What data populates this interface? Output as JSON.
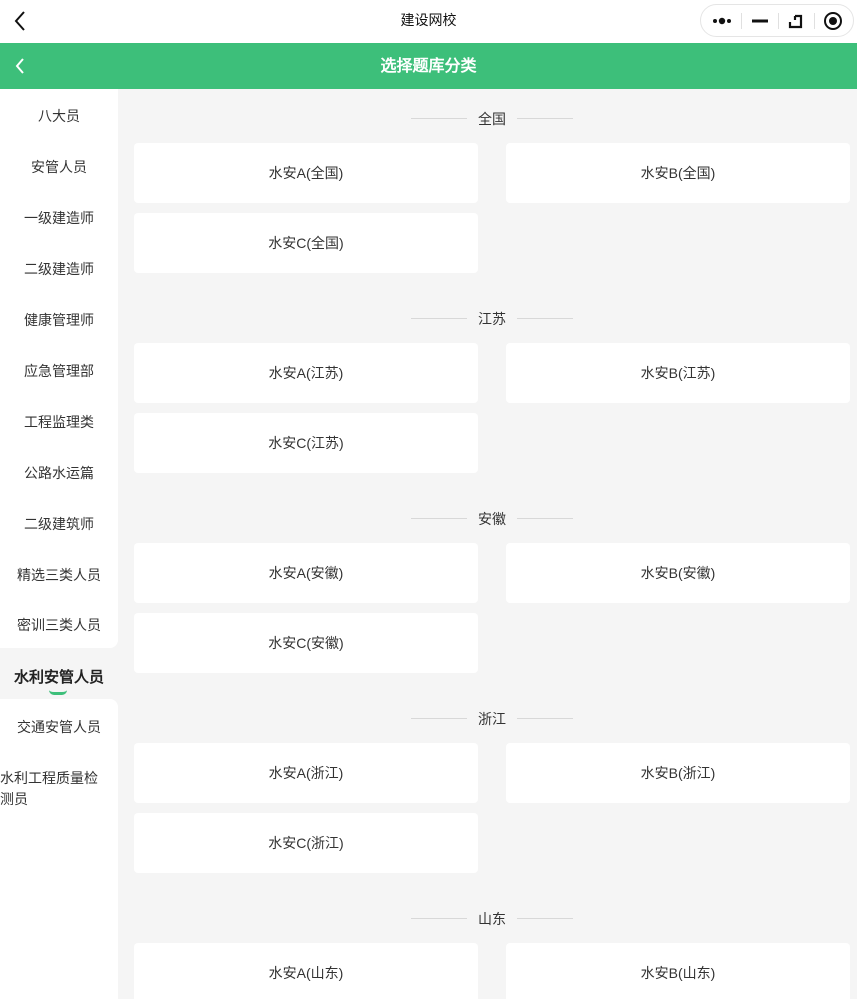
{
  "topbar": {
    "title": "建设网校"
  },
  "header": {
    "title": "选择题库分类"
  },
  "sidebar": {
    "items": [
      {
        "label": "八大员"
      },
      {
        "label": "安管人员"
      },
      {
        "label": "一级建造师"
      },
      {
        "label": "二级建造师"
      },
      {
        "label": "健康管理师"
      },
      {
        "label": "应急管理部"
      },
      {
        "label": "工程监理类"
      },
      {
        "label": "公路水运篇"
      },
      {
        "label": "二级建筑师"
      },
      {
        "label": "精选三类人员"
      },
      {
        "label": "密训三类人员"
      },
      {
        "label": "水利安管人员"
      },
      {
        "label": "交通安管人员"
      },
      {
        "label": "水利工程质量检",
        "label2": "测员"
      }
    ],
    "active_index": 11
  },
  "sections": [
    {
      "title": "全国",
      "items": [
        "水安A(全国)",
        "水安B(全国)",
        "水安C(全国)"
      ]
    },
    {
      "title": "江苏",
      "items": [
        "水安A(江苏)",
        "水安B(江苏)",
        "水安C(江苏)"
      ]
    },
    {
      "title": "安徽",
      "items": [
        "水安A(安徽)",
        "水安B(安徽)",
        "水安C(安徽)"
      ]
    },
    {
      "title": "浙江",
      "items": [
        "水安A(浙江)",
        "水安B(浙江)",
        "水安C(浙江)"
      ]
    },
    {
      "title": "山东",
      "items": [
        "水安A(山东)",
        "水安B(山东)"
      ]
    }
  ],
  "icons": {
    "back": "chevron-left-icon",
    "more": "more-dots-icon",
    "minimize": "minimize-icon",
    "share": "share-icon",
    "close": "close-target-icon"
  },
  "colors": {
    "accent": "#3dbf7a",
    "background": "#f5f5f5",
    "card": "#ffffff"
  }
}
